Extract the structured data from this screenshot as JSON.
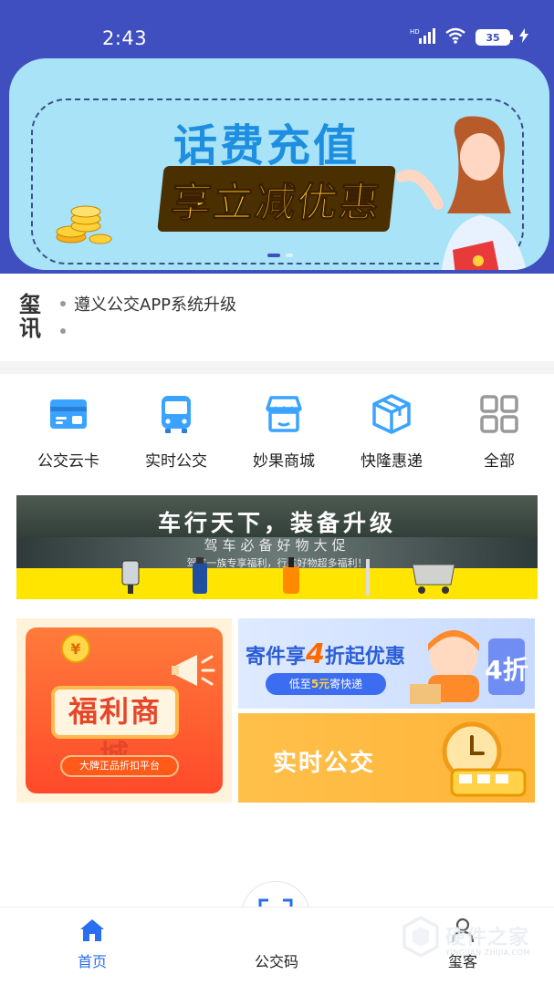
{
  "status_bar": {
    "time": "2:43",
    "battery": "35",
    "network": "HD"
  },
  "banner": {
    "title": "话费充值",
    "subtitle": "享立减优惠"
  },
  "news": {
    "logo_line1": "玺",
    "logo_line2": "讯",
    "items": [
      "遵义公交APP系统升级",
      ""
    ]
  },
  "grid": [
    {
      "label": "公交云卡",
      "icon": "bus-card-icon"
    },
    {
      "label": "实时公交",
      "icon": "bus-icon"
    },
    {
      "label": "妙果商城",
      "icon": "shop-icon"
    },
    {
      "label": "快隆惠递",
      "icon": "package-icon"
    },
    {
      "label": "全部",
      "icon": "grid-icon"
    }
  ],
  "promo": {
    "title": "车行天下，装备升级",
    "subtitle": "驾车必备好物大促",
    "subtitle2": "驾车一族专享福利，行车好物超多福利！"
  },
  "cards": {
    "left_title": "福利商城",
    "left_pill": "大牌正品折扣平台",
    "right_top_title_a": "寄件享",
    "right_top_title_num": "4",
    "right_top_title_b": "折起优惠",
    "right_top_pill_a": "低至",
    "right_top_pill_num": "5元",
    "right_top_pill_b": "寄快递",
    "right_top_badge": "4折",
    "right_bottom_title": "实时公交"
  },
  "bottom_nav": {
    "home": "首页",
    "code": "公交码",
    "mine": "玺客"
  },
  "watermark": {
    "text": "硬件之家",
    "url": "YINGJIAN ZHIJIA.COM"
  },
  "colors": {
    "brand": "#3f4fbf",
    "accent": "#2a6ef0",
    "banner_bg": "#a8e3f7"
  }
}
